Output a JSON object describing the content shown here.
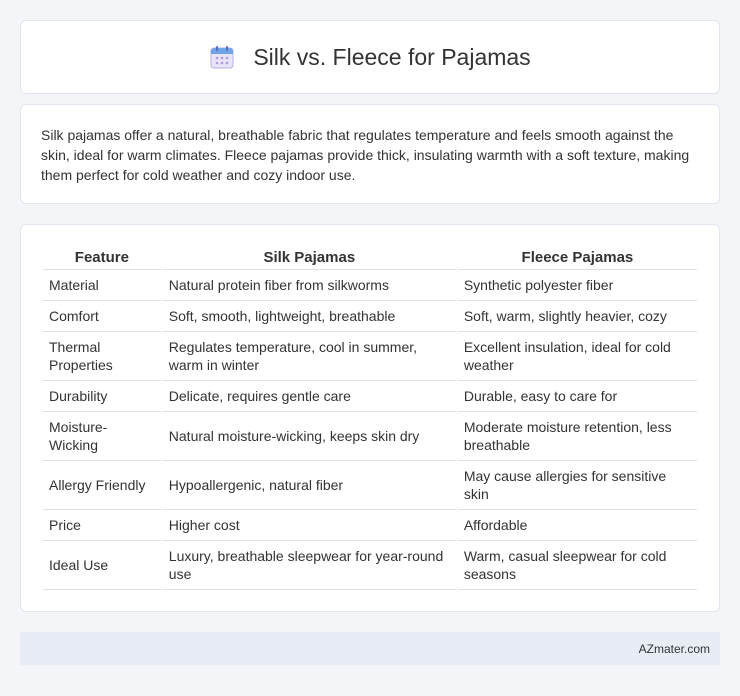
{
  "header": {
    "title": "Silk vs. Fleece for Pajamas",
    "icon": "calendar-icon"
  },
  "intro": {
    "text": "Silk pajamas offer a natural, breathable fabric that regulates temperature and feels smooth against the skin, ideal for warm climates. Fleece pajamas provide thick, insulating warmth with a soft texture, making them perfect for cold weather and cozy indoor use."
  },
  "table": {
    "headers": [
      "Feature",
      "Silk Pajamas",
      "Fleece Pajamas"
    ],
    "rows": [
      [
        "Material",
        "Natural protein fiber from silkworms",
        "Synthetic polyester fiber"
      ],
      [
        "Comfort",
        "Soft, smooth, lightweight, breathable",
        "Soft, warm, slightly heavier, cozy"
      ],
      [
        "Thermal Properties",
        "Regulates temperature, cool in summer, warm in winter",
        "Excellent insulation, ideal for cold weather"
      ],
      [
        "Durability",
        "Delicate, requires gentle care",
        "Durable, easy to care for"
      ],
      [
        "Moisture-Wicking",
        "Natural moisture-wicking, keeps skin dry",
        "Moderate moisture retention, less breathable"
      ],
      [
        "Allergy Friendly",
        "Hypoallergenic, natural fiber",
        "May cause allergies for sensitive skin"
      ],
      [
        "Price",
        "Higher cost",
        "Affordable"
      ],
      [
        "Ideal Use",
        "Luxury, breathable sleepwear for year-round use",
        "Warm, casual sleepwear for cold seasons"
      ]
    ]
  },
  "footer": {
    "brand": "AZmater.com"
  },
  "colors": {
    "background": "#f3f5f9",
    "card": "#ffffff",
    "footer": "#e8edf5",
    "text": "#333333"
  }
}
